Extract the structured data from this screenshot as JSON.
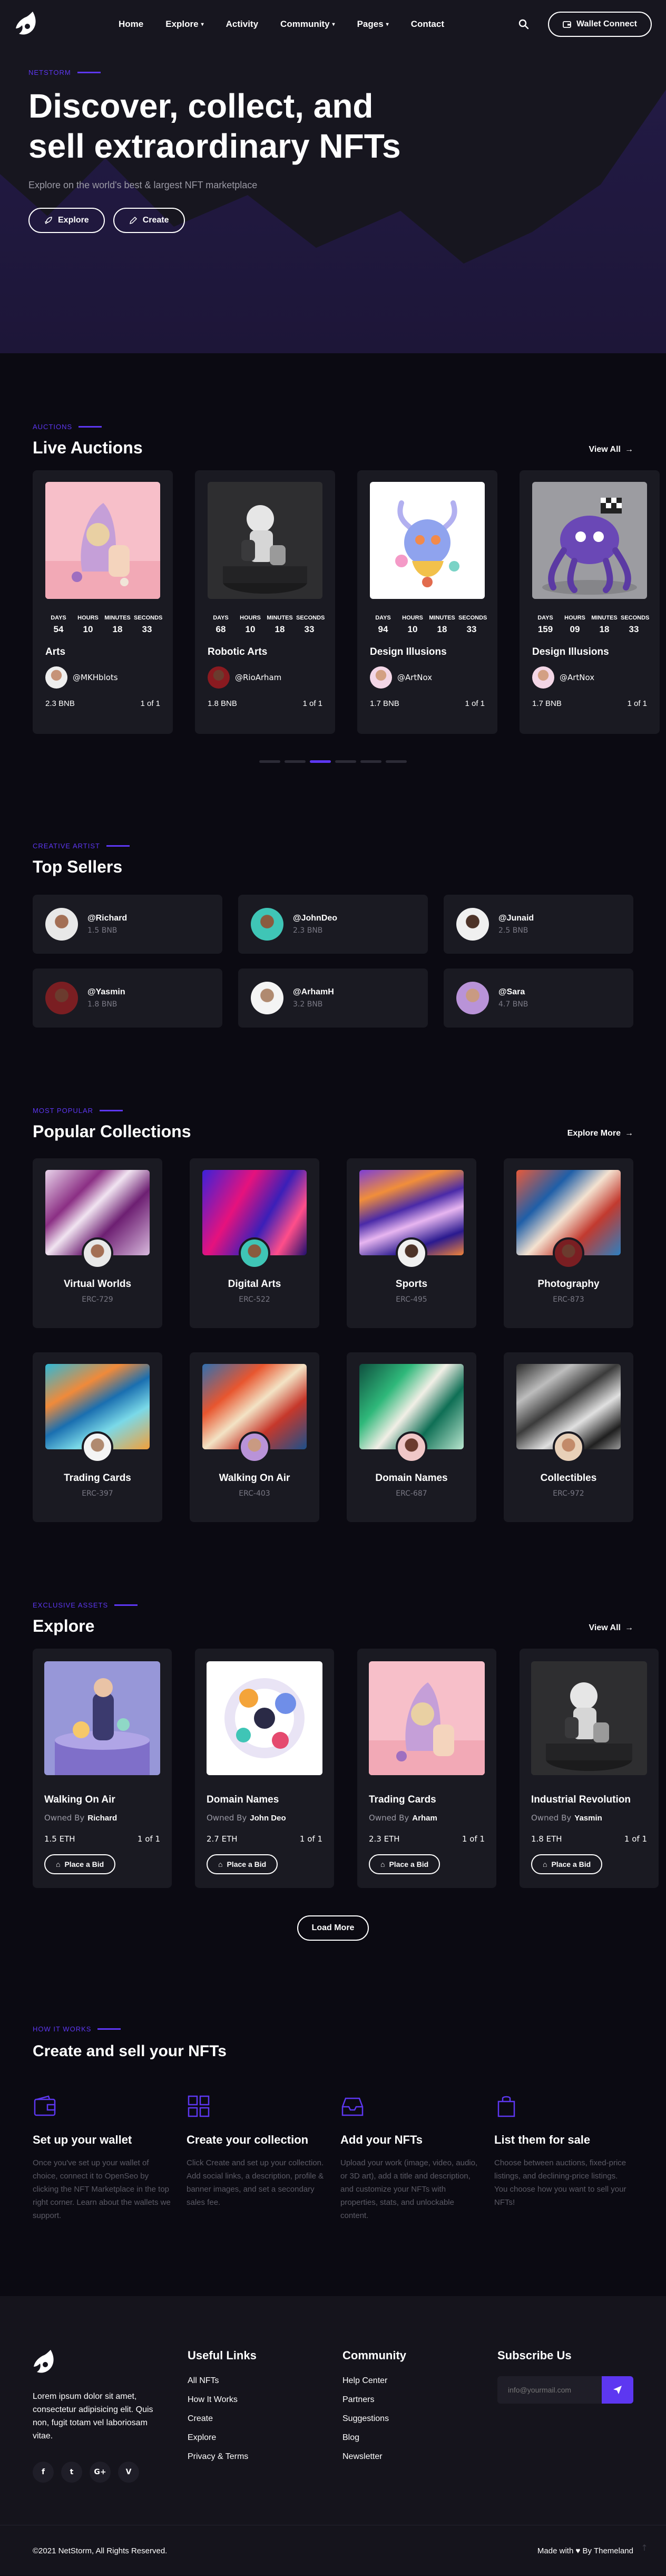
{
  "brand": {
    "accent": "#5d37f1",
    "background": "#0b0a12",
    "card": "#1a1a22"
  },
  "nav": {
    "items": [
      {
        "label": "Home",
        "caret": false
      },
      {
        "label": "Explore",
        "caret": true
      },
      {
        "label": "Activity",
        "caret": false
      },
      {
        "label": "Community",
        "caret": true
      },
      {
        "label": "Pages",
        "caret": true
      },
      {
        "label": "Contact",
        "caret": false
      }
    ],
    "wallet_label": "Wallet Connect"
  },
  "hero": {
    "eyebrow": "NETSTORM",
    "title": "Discover, collect, and sell extraordinary NFTs",
    "subtitle": "Explore on the world's best & largest NFT marketplace",
    "explore_label": "Explore",
    "create_label": "Create"
  },
  "auctions": {
    "eyebrow": "AUCTIONS",
    "title": "Live Auctions",
    "view_all": "View All",
    "timer_labels": [
      "DAYS",
      "HOURS",
      "MINUTES",
      "SECONDS"
    ],
    "items": [
      {
        "title": "Arts",
        "owner": "@MKHblots",
        "price": "2.3 BNB",
        "edition": "1 of 1",
        "timer": [
          "54",
          "10",
          "18",
          "33"
        ]
      },
      {
        "title": "Robotic Arts",
        "owner": "@RioArham",
        "price": "1.8 BNB",
        "edition": "1 of 1",
        "timer": [
          "68",
          "10",
          "18",
          "33"
        ]
      },
      {
        "title": "Design Illusions",
        "owner": "@ArtNox",
        "price": "1.7 BNB",
        "edition": "1 of 1",
        "timer": [
          "94",
          "10",
          "18",
          "33"
        ]
      },
      {
        "title": "Design Illusions",
        "owner": "@ArtNox",
        "price": "1.7 BNB",
        "edition": "1 of 1",
        "timer": [
          "159",
          "09",
          "18",
          "33"
        ]
      }
    ]
  },
  "sellers": {
    "eyebrow": "CREATIVE ARTIST",
    "title": "Top Sellers",
    "items": [
      {
        "name": "@Richard",
        "amount": "1.5 BNB"
      },
      {
        "name": "@JohnDeo",
        "amount": "2.3 BNB"
      },
      {
        "name": "@Junaid",
        "amount": "2.5 BNB"
      },
      {
        "name": "@Yasmin",
        "amount": "1.8 BNB"
      },
      {
        "name": "@ArhamH",
        "amount": "3.2 BNB"
      },
      {
        "name": "@Sara",
        "amount": "4.7 BNB"
      }
    ]
  },
  "collections": {
    "eyebrow": "MOST POPULAR",
    "title": "Popular Collections",
    "explore_more": "Explore More",
    "items": [
      {
        "title": "Virtual Worlds",
        "code": "ERC-729"
      },
      {
        "title": "Digital Arts",
        "code": "ERC-522"
      },
      {
        "title": "Sports",
        "code": "ERC-495"
      },
      {
        "title": "Photography",
        "code": "ERC-873"
      },
      {
        "title": "Trading Cards",
        "code": "ERC-397"
      },
      {
        "title": "Walking On Air",
        "code": "ERC-403"
      },
      {
        "title": "Domain Names",
        "code": "ERC-687"
      },
      {
        "title": "Collectibles",
        "code": "ERC-972"
      }
    ]
  },
  "explore": {
    "eyebrow": "EXCLUSIVE ASSETS",
    "title": "Explore",
    "view_all": "View All",
    "owned_by": "Owned By",
    "bid_label": "Place a Bid",
    "load_more": "Load More",
    "items": [
      {
        "title": "Walking On Air",
        "owner": "Richard",
        "price": "1.5 ETH",
        "edition": "1 of 1"
      },
      {
        "title": "Domain Names",
        "owner": "John Deo",
        "price": "2.7 ETH",
        "edition": "1 of 1"
      },
      {
        "title": "Trading Cards",
        "owner": "Arham",
        "price": "2.3 ETH",
        "edition": "1 of 1"
      },
      {
        "title": "Industrial Revolution",
        "owner": "Yasmin",
        "price": "1.8 ETH",
        "edition": "1 of 1"
      }
    ]
  },
  "how": {
    "eyebrow": "HOW IT WORKS",
    "title": "Create and sell your NFTs",
    "steps": [
      {
        "title": "Set up your wallet",
        "text": "Once you've set up your wallet of choice, connect it to OpenSeo by clicking the NFT Marketplace in the top right corner. Learn about the wallets we support.",
        "icon": "wallet-icon"
      },
      {
        "title": "Create your collection",
        "text": "Click Create and set up your collection. Add social links, a description, profile & banner images, and set a secondary sales fee.",
        "icon": "grid-icon"
      },
      {
        "title": "Add your NFTs",
        "text": "Upload your work (image, video, audio, or 3D art), add a title and description, and customize your NFTs with properties, stats, and unlockable content.",
        "icon": "inbox-icon"
      },
      {
        "title": "List them for sale",
        "text": "Choose between auctions, fixed-price listings, and declining-price listings. You choose how you want to sell your NFTs!",
        "icon": "bag-icon"
      }
    ]
  },
  "footer": {
    "about": "Lorem ipsum dolor sit amet, consectetur adipisicing elit. Quis non, fugit totam vel laboriosam vitae.",
    "socials": [
      "f",
      "t",
      "G+",
      "V"
    ],
    "useful": {
      "title": "Useful Links",
      "links": [
        "All NFTs",
        "How It Works",
        "Create",
        "Explore",
        "Privacy & Terms"
      ]
    },
    "community": {
      "title": "Community",
      "links": [
        "Help Center",
        "Partners",
        "Suggestions",
        "Blog",
        "Newsletter"
      ]
    },
    "subscribe": {
      "title": "Subscribe Us",
      "placeholder": "info@yourmail.com"
    },
    "copyright": "©2021 NetStorm, All Rights Reserved.",
    "made_with": "Made with",
    "by": "By Themeland"
  }
}
